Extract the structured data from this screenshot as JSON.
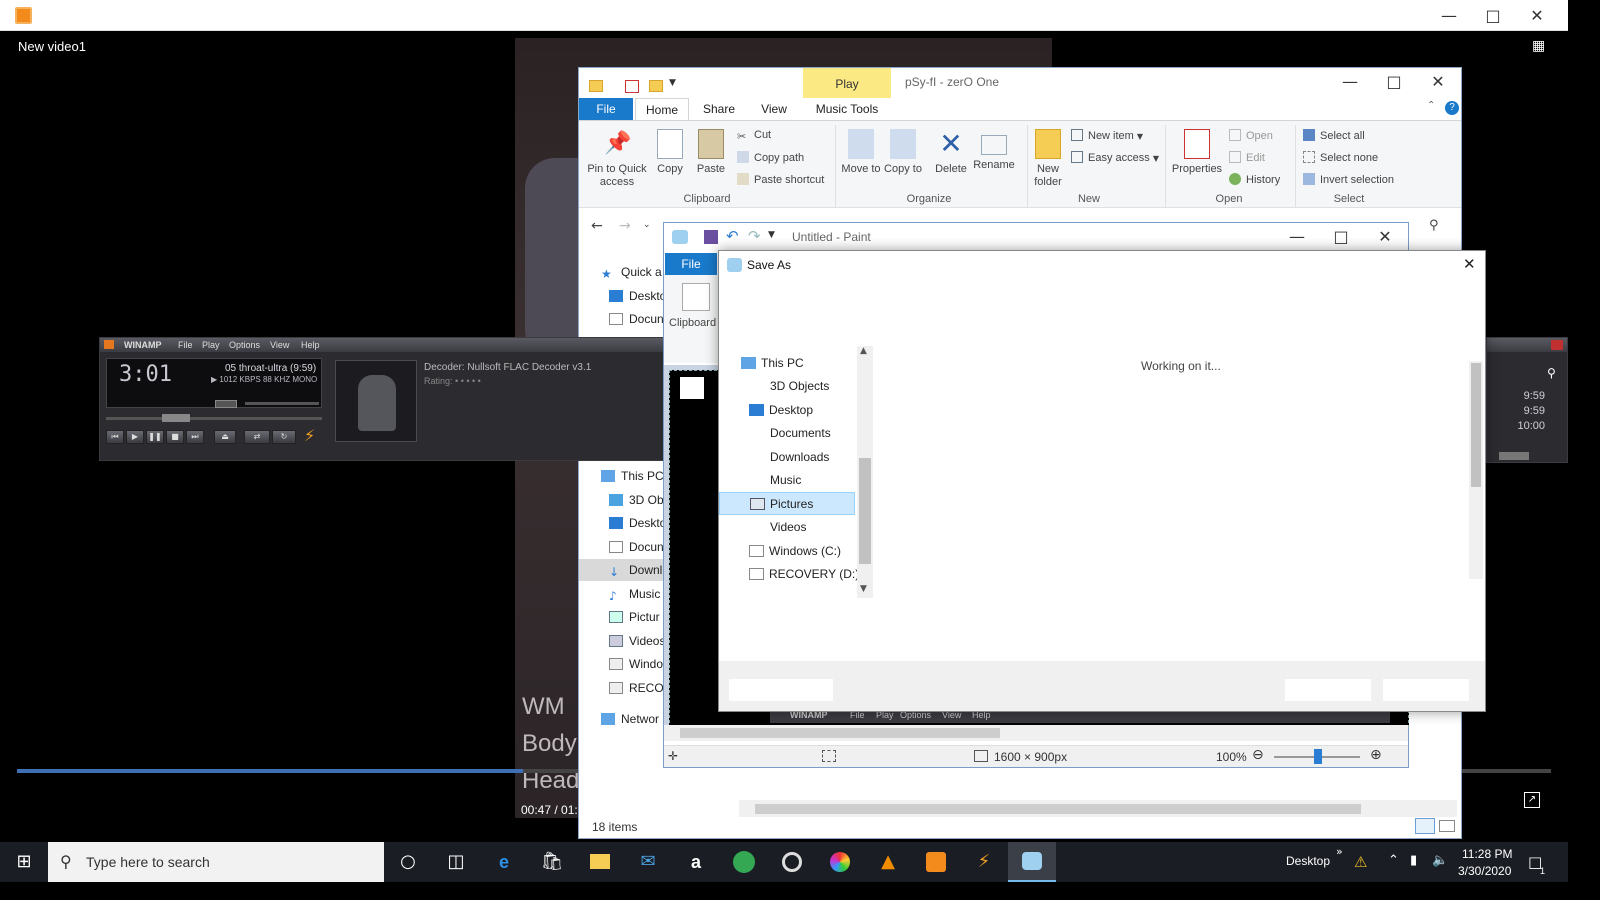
{
  "player": {
    "window_title": "",
    "video_title": "New video1",
    "overlay_lines": [
      "WM",
      "Body",
      "Head"
    ],
    "time_display": "00:47 / 01:4",
    "progress": 0.33
  },
  "explorer": {
    "title": "pSy-fI - zerO One",
    "contextual_tab": "Play",
    "tabs": [
      "File",
      "Home",
      "Share",
      "View",
      "Music Tools"
    ],
    "clipboard": {
      "pin": "Pin to Quick access",
      "copy": "Copy",
      "paste": "Paste",
      "cut": "Cut",
      "copy_path": "Copy path",
      "paste_shortcut": "Paste shortcut",
      "label": "Clipboard"
    },
    "organize": {
      "move_to": "Move to",
      "copy_to": "Copy to",
      "delete": "Delete",
      "rename": "Rename",
      "label": "Organize"
    },
    "new": {
      "new_folder": "New folder",
      "new_item": "New item",
      "easy_access": "Easy access",
      "label": "New"
    },
    "open": {
      "properties": "Properties",
      "open": "Open",
      "edit": "Edit",
      "history": "History",
      "label": "Open"
    },
    "select": {
      "select_all": "Select all",
      "select_none": "Select none",
      "invert": "Invert selection",
      "label": "Select"
    },
    "tree": [
      "Quick a",
      "Deskto",
      "Docun",
      "This PC",
      "3D Ob",
      "Deskto",
      "Docun",
      "Downl",
      "Music",
      "Pictur",
      "Videos",
      "Windo",
      "RECOV",
      "Networ"
    ],
    "status": "18 items"
  },
  "winamp": {
    "title": "WINAMP",
    "menu": [
      "File",
      "Play",
      "Options",
      "View",
      "Help"
    ],
    "time": "3:01",
    "track": "05 throat-ultra (9:59)",
    "kbps": "1012",
    "khz": "88",
    "mode": "MONO",
    "decoder": "Decoder: Nullsoft FLAC Decoder v3.1",
    "rating": "Rating:"
  },
  "playlist": {
    "durations": [
      "9:59",
      "9:59",
      "10:00"
    ]
  },
  "paint": {
    "title": "Untitled - Paint",
    "file_tab": "File",
    "clipboard_label": "Clipboard",
    "dimensions": "1600 × 900px",
    "zoom": "100%",
    "thumb_menu": [
      "WINAMP",
      "File",
      "Play",
      "Options",
      "View",
      "Help"
    ]
  },
  "saveas": {
    "title": "Save As",
    "status": "Working on it...",
    "tree": [
      {
        "label": "This PC",
        "icon": "pc-icon"
      },
      {
        "label": "3D Objects",
        "icon": ""
      },
      {
        "label": "Desktop",
        "icon": "desktop-icon"
      },
      {
        "label": "Documents",
        "icon": ""
      },
      {
        "label": "Downloads",
        "icon": ""
      },
      {
        "label": "Music",
        "icon": ""
      },
      {
        "label": "Pictures",
        "icon": "pictures-icon"
      },
      {
        "label": "Videos",
        "icon": ""
      },
      {
        "label": "Windows (C:)",
        "icon": "drive-icon"
      },
      {
        "label": "RECOVERY (D:)",
        "icon": "drive-icon"
      }
    ]
  },
  "taskbar": {
    "search_placeholder": "Type here to search",
    "desktop_label": "Desktop",
    "time": "11:28 PM",
    "date": "3/30/2020",
    "notification_count": "1"
  }
}
